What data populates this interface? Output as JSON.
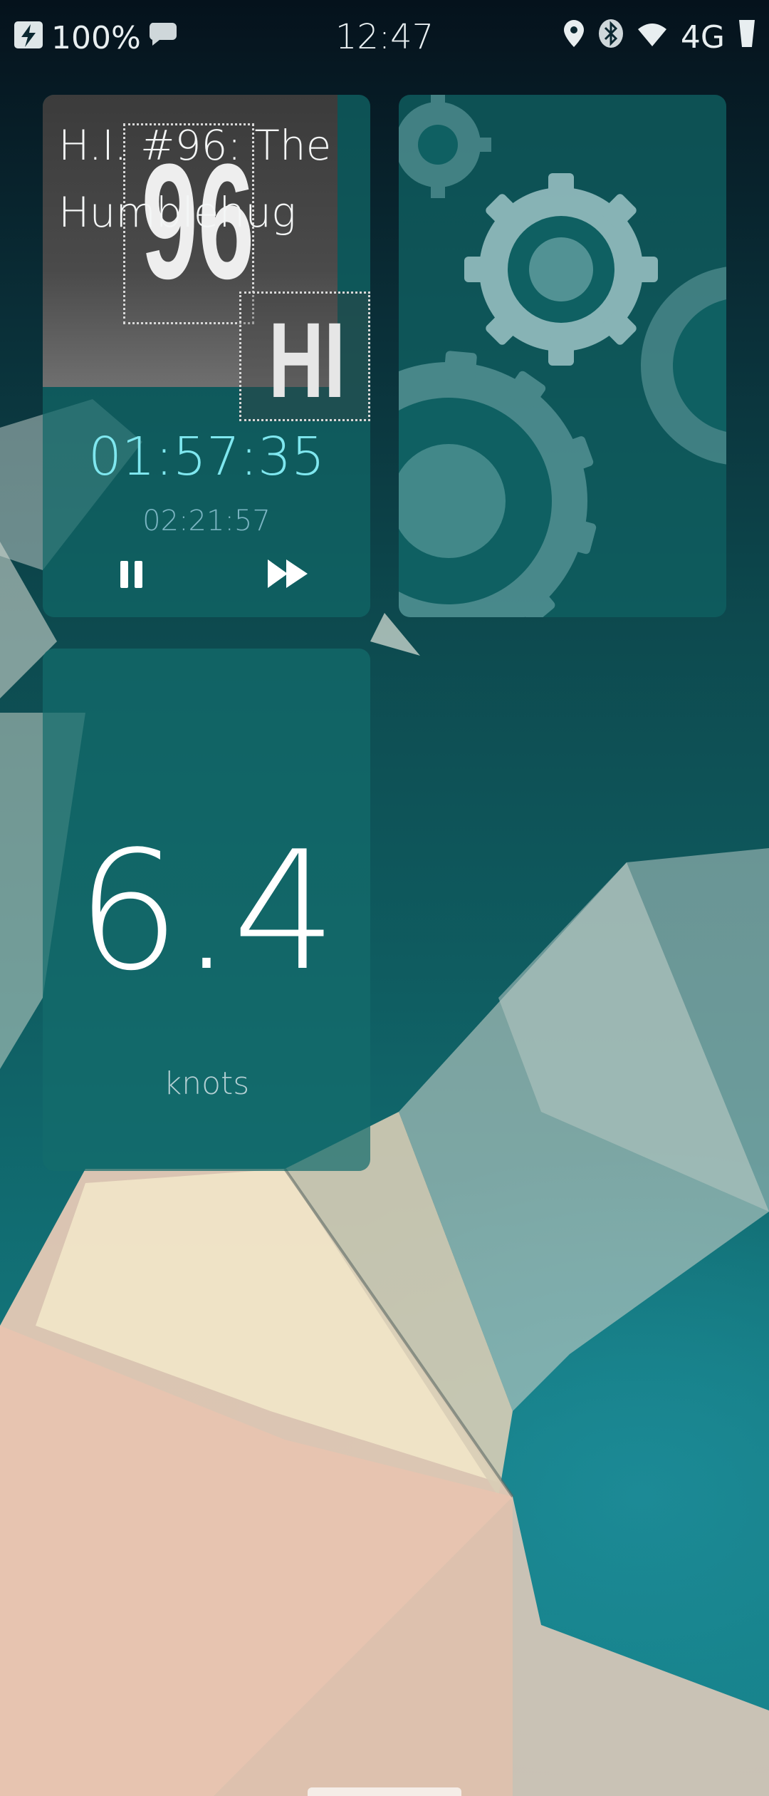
{
  "status_bar": {
    "battery_percent": "100%",
    "time": "12:47",
    "network": "4G",
    "icons": [
      "charging-icon",
      "notification-icon",
      "location-icon",
      "bluetooth-icon",
      "wifi-icon",
      "signal-icon"
    ]
  },
  "podcast_card": {
    "episode_title": "H.I. #96: The Humblehug",
    "cover_number": "96",
    "cover_letters": "HI",
    "elapsed": "01:57:35",
    "duration": "02:21:57",
    "pause_icon": "pause-icon",
    "forward_icon": "fast-forward-icon"
  },
  "settings_card": {
    "icon": "gears-icon"
  },
  "speed_card": {
    "value": "6.4",
    "unit": "knots"
  },
  "colors": {
    "elapsed_text": "#7fe7ef",
    "duration_text": "#7ab4c2",
    "card_bg": "#106868"
  }
}
